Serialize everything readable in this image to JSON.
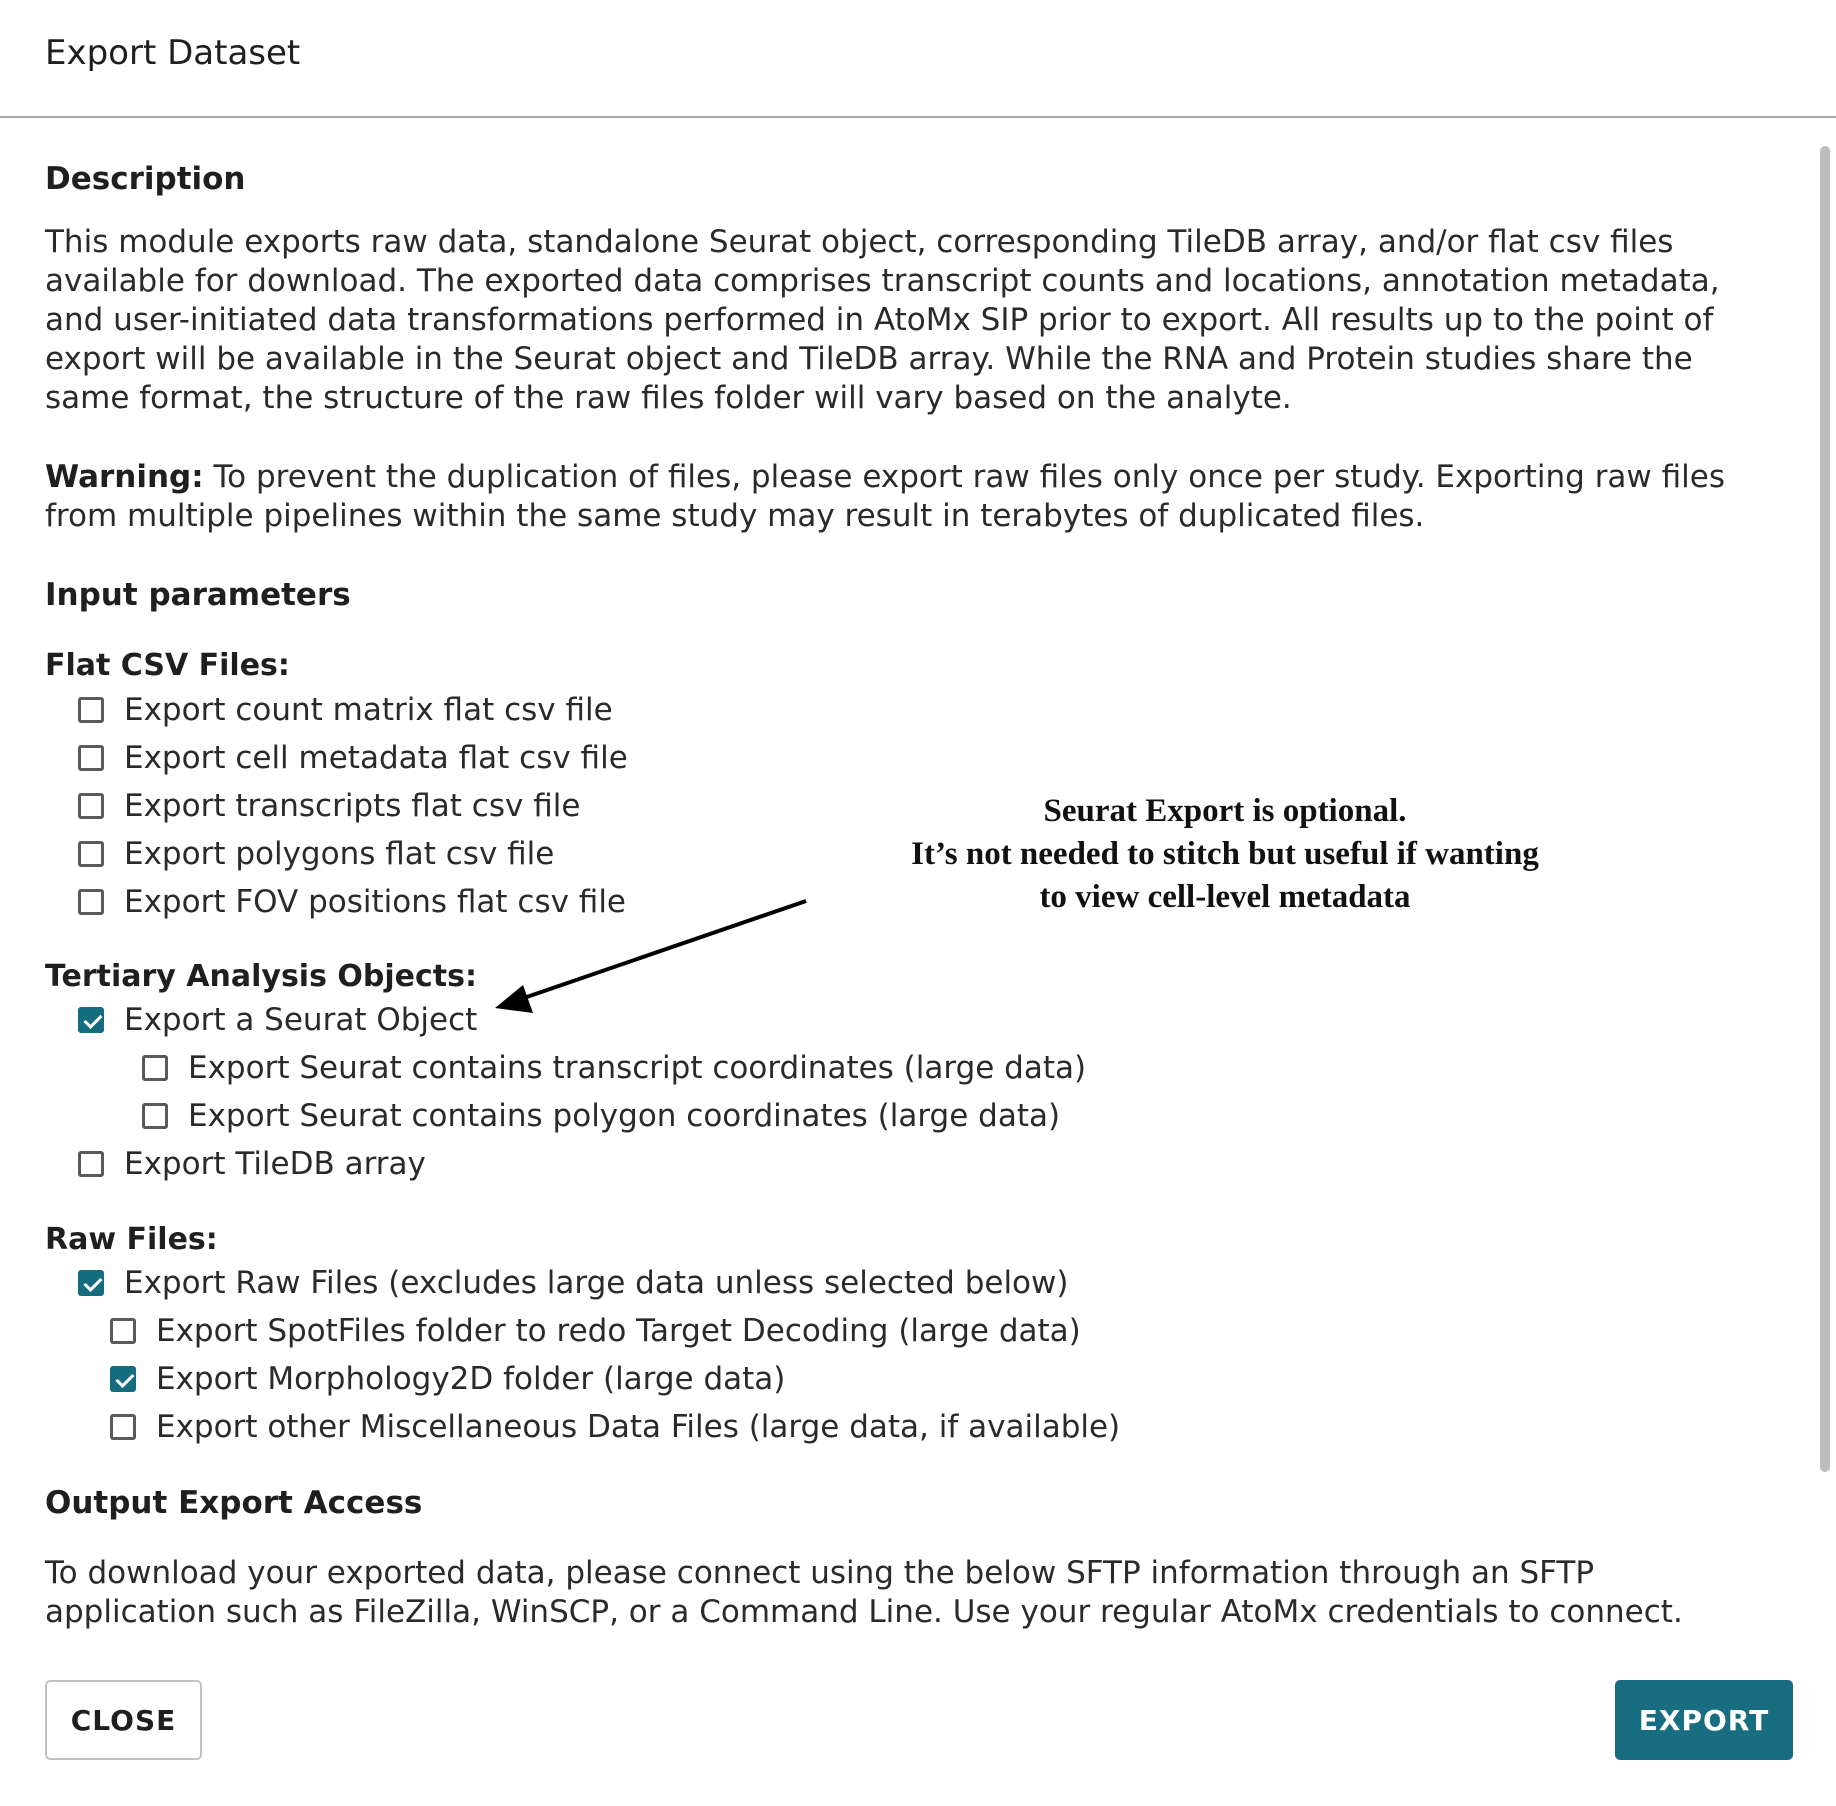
{
  "dialog": {
    "title": "Export Dataset"
  },
  "description": {
    "heading": "Description",
    "text": "This module exports raw data, standalone Seurat object, corresponding TileDB array, and/or flat csv files available for download. The exported data comprises transcript counts and locations, annotation metadata, and user-initiated data transformations performed in AtoMx SIP prior to export. All results up to the point of export will be available in the Seurat object and TileDB array. While the RNA and Protein studies share the same format, the structure of the raw files folder will vary based on the analyte.",
    "warning_label": "Warning:",
    "warning_text": " To prevent the duplication of files, please export raw files only once per study. Exporting raw files from multiple pipelines within the same study may result in terabytes of duplicated files."
  },
  "input_parameters": {
    "heading": "Input parameters",
    "flat_csv": {
      "label": "Flat CSV Files:",
      "options": [
        {
          "label": "Export count matrix flat csv file",
          "checked": false
        },
        {
          "label": "Export cell metadata flat csv file",
          "checked": false
        },
        {
          "label": "Export transcripts flat csv file",
          "checked": false
        },
        {
          "label": "Export polygons flat csv file",
          "checked": false
        },
        {
          "label": "Export FOV positions flat csv file",
          "checked": false
        }
      ]
    },
    "tertiary": {
      "label": "Tertiary Analysis Objects:",
      "seurat": {
        "label": "Export a Seurat Object",
        "checked": true
      },
      "seurat_transcripts": {
        "label": "Export Seurat contains transcript coordinates (large data)",
        "checked": false
      },
      "seurat_polygons": {
        "label": "Export Seurat contains polygon coordinates (large data)",
        "checked": false
      },
      "tiledb": {
        "label": "Export TileDB array",
        "checked": false
      }
    },
    "raw_files": {
      "label": "Raw Files:",
      "raw": {
        "label": "Export Raw Files (excludes large data unless selected below)",
        "checked": true
      },
      "spotfiles": {
        "label": "Export SpotFiles folder to redo Target Decoding (large data)",
        "checked": false
      },
      "morphology": {
        "label": "Export Morphology2D folder (large data)",
        "checked": true
      },
      "misc": {
        "label": "Export other Miscellaneous Data Files (large data, if available)",
        "checked": false
      }
    }
  },
  "output_access": {
    "heading": "Output Export Access",
    "text": "To download your exported data, please connect using the below SFTP information through an SFTP application such as FileZilla, WinSCP, or a Command Line. Use your regular AtoMx credentials to connect."
  },
  "annotation": {
    "line1": "Seurat Export is optional.",
    "line2": "It’s not needed to stitch but useful if wanting",
    "line3": "to view cell-level metadata"
  },
  "footer": {
    "close_label": "CLOSE",
    "export_label": "EXPORT"
  },
  "colors": {
    "accent": "#186e80",
    "checkbox_checked": "#136d7e",
    "divider": "#a9a9a9"
  }
}
